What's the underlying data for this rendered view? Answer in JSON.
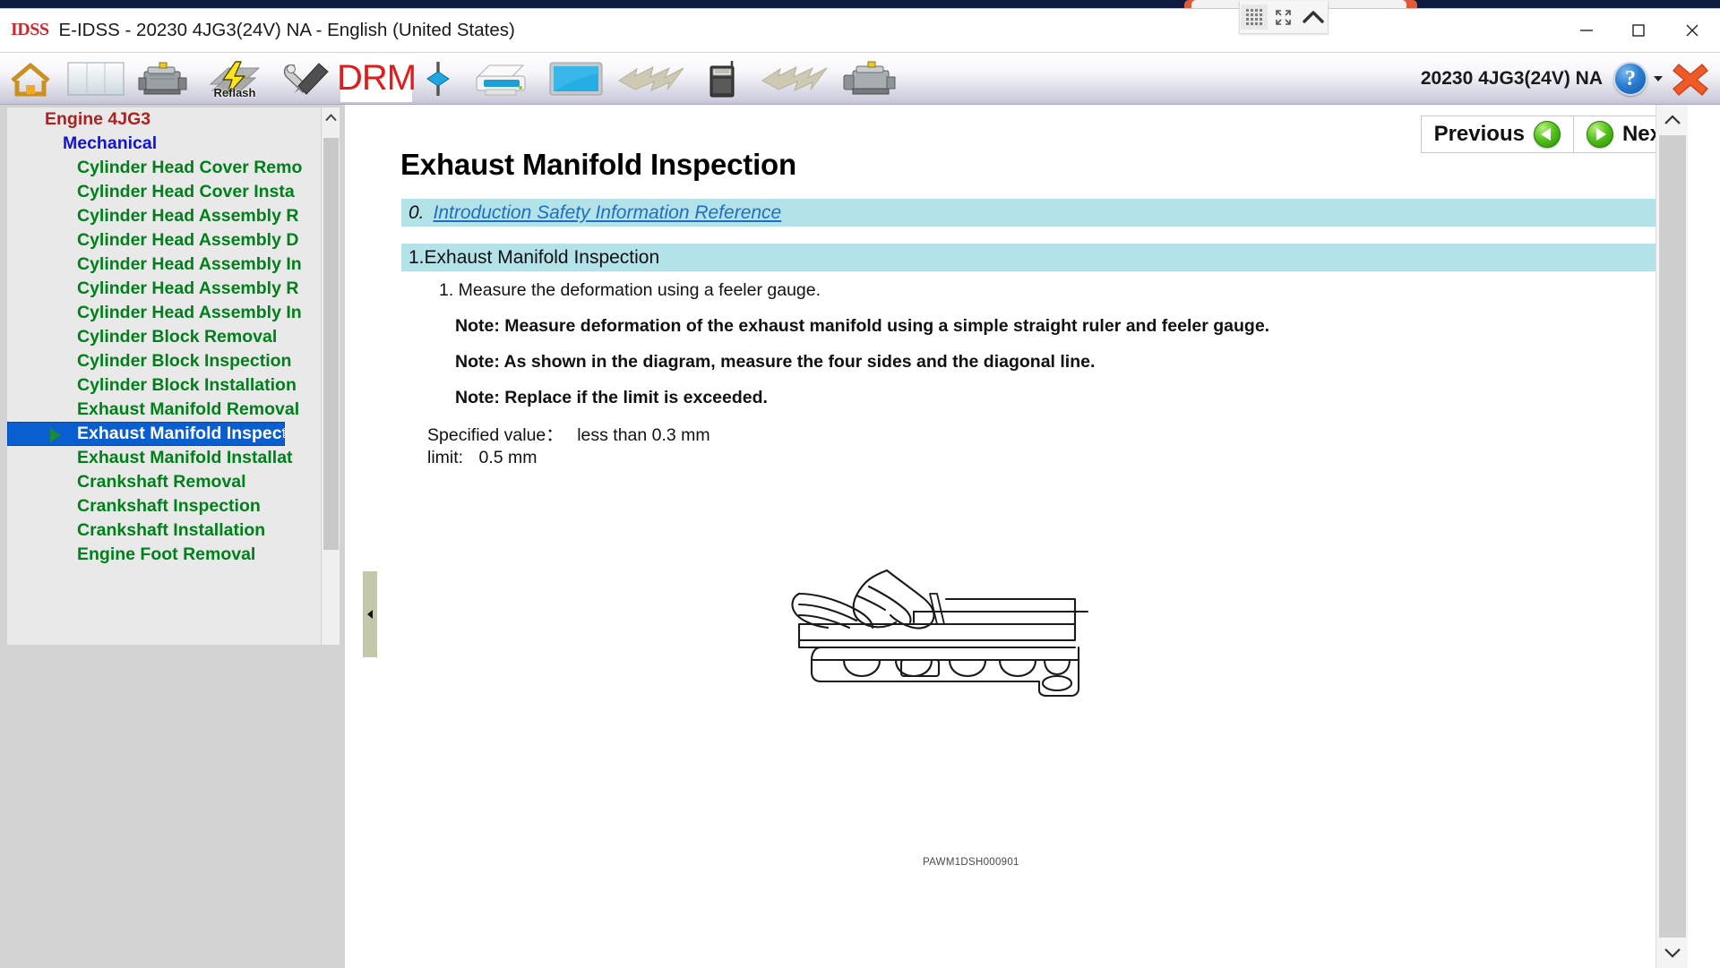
{
  "window": {
    "logo_text": "IDSS",
    "title": "E-IDSS - 20230 4JG3(24V)  NA - English (United States)",
    "minimize_label": "—",
    "maximize_label": "☐",
    "close_label": "✕"
  },
  "float_toolbar": {
    "grid_icon": "grid-dots-icon",
    "expand_icon": "expand-arrows-icon",
    "collapse_icon": "chevron-up-icon"
  },
  "toolbar": {
    "items": [
      {
        "name": "home-icon",
        "label": ""
      },
      {
        "name": "cylinder-icon",
        "label": ""
      },
      {
        "name": "engine-icon",
        "label": ""
      },
      {
        "name": "reflash-icon",
        "label": "Reflash"
      },
      {
        "name": "tools-icon",
        "label": ""
      },
      {
        "name": "drm-icon",
        "label": "DRM"
      },
      {
        "name": "connector-icon",
        "label": ""
      },
      {
        "name": "printer-icon",
        "label": ""
      },
      {
        "name": "laptop-icon",
        "label": ""
      },
      {
        "name": "lightning-arrow-icon",
        "label": ""
      },
      {
        "name": "interface-module-icon",
        "label": ""
      },
      {
        "name": "lightning-arrow-2-icon",
        "label": ""
      },
      {
        "name": "engine-2-icon",
        "label": ""
      }
    ],
    "drm_text": "DRM",
    "vehicle": "20230 4JG3(24V)  NA",
    "help_label": "?",
    "close_x_icon": "close-red-x-icon"
  },
  "sidebar": {
    "tree": [
      {
        "label": "Engine 4JG3",
        "level": 0,
        "selected": false,
        "arrow": false
      },
      {
        "label": "Mechanical",
        "level": 1,
        "selected": false,
        "arrow": false
      },
      {
        "label": "Cylinder Head Cover Remo",
        "level": 2,
        "selected": false,
        "arrow": false
      },
      {
        "label": "Cylinder Head Cover Insta",
        "level": 2,
        "selected": false,
        "arrow": false
      },
      {
        "label": "Cylinder Head Assembly R",
        "level": 2,
        "selected": false,
        "arrow": false
      },
      {
        "label": "Cylinder Head Assembly D",
        "level": 2,
        "selected": false,
        "arrow": false
      },
      {
        "label": "Cylinder Head Assembly In",
        "level": 2,
        "selected": false,
        "arrow": false
      },
      {
        "label": "Cylinder Head Assembly R",
        "level": 2,
        "selected": false,
        "arrow": false
      },
      {
        "label": "Cylinder Head Assembly In",
        "level": 2,
        "selected": false,
        "arrow": false
      },
      {
        "label": "Cylinder Block Removal",
        "level": 2,
        "selected": false,
        "arrow": false
      },
      {
        "label": "Cylinder Block Inspection",
        "level": 2,
        "selected": false,
        "arrow": false
      },
      {
        "label": "Cylinder Block Installation",
        "level": 2,
        "selected": false,
        "arrow": false
      },
      {
        "label": "Exhaust Manifold Removal",
        "level": 2,
        "selected": false,
        "arrow": false
      },
      {
        "label": "Exhaust Manifold Inspecti",
        "level": 2,
        "selected": true,
        "arrow": true
      },
      {
        "label": "Exhaust Manifold Installat",
        "level": 2,
        "selected": false,
        "arrow": false
      },
      {
        "label": "Crankshaft Removal",
        "level": 2,
        "selected": false,
        "arrow": false
      },
      {
        "label": "Crankshaft Inspection",
        "level": 2,
        "selected": false,
        "arrow": false
      },
      {
        "label": "Crankshaft Installation",
        "level": 2,
        "selected": false,
        "arrow": false
      },
      {
        "label": "Engine Foot Removal",
        "level": 2,
        "selected": false,
        "arrow": false
      }
    ],
    "scroll_up_icon": "chevron-up-icon",
    "collapse_handle_icon": "chevron-left-icon"
  },
  "content": {
    "nav": {
      "previous_label": "Previous",
      "next_label": "Next"
    },
    "page_title": "Exhaust Manifold Inspection",
    "bands": [
      {
        "num": "0.",
        "text": "Introduction Safety Information Reference",
        "link": true
      },
      {
        "num": "1.",
        "text": "Exhaust Manifold Inspection",
        "link": false
      }
    ],
    "step": "1. Measure the deformation using a feeler gauge.",
    "notes": [
      "Note: Measure deformation of the exhaust manifold using a simple straight ruler and feeler gauge.",
      "Note: As shown in the diagram, measure the four sides and the diagonal line.",
      "Note: Replace if the limit is exceeded."
    ],
    "spec_label": "Specified value：",
    "spec_value": "less than 0.3 mm",
    "limit_label": "limit:",
    "limit_value": "0.5 mm",
    "figure_caption": "PAWM1DSH000901",
    "scroll_up_icon": "chevron-up-icon",
    "scroll_down_icon": "chevron-down-icon"
  },
  "colors": {
    "band": "#b3e2e8",
    "selection": "#0a5fd0",
    "tree_level0": "#aa2222",
    "tree_level1": "#1414d0",
    "tree_level2": "#00801a",
    "link": "#1d6fc4",
    "desktop": "#0d1b3e"
  }
}
